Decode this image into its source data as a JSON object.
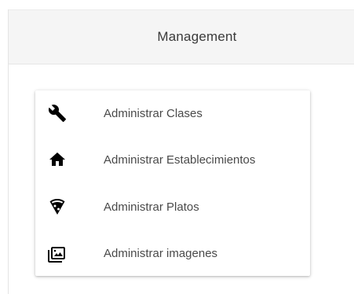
{
  "header": {
    "title": "Management"
  },
  "menu": {
    "items": [
      {
        "label": "Administrar Clases",
        "icon": "wrench-icon"
      },
      {
        "label": "Administrar Establecimientos",
        "icon": "home-icon"
      },
      {
        "label": "Administrar Platos",
        "icon": "pizza-icon"
      },
      {
        "label": "Administrar imagenes",
        "icon": "image-icon"
      }
    ]
  },
  "colors": {
    "header_bg": "#f5f5f5",
    "text": "#4a4a4a",
    "icon": "#000000"
  }
}
